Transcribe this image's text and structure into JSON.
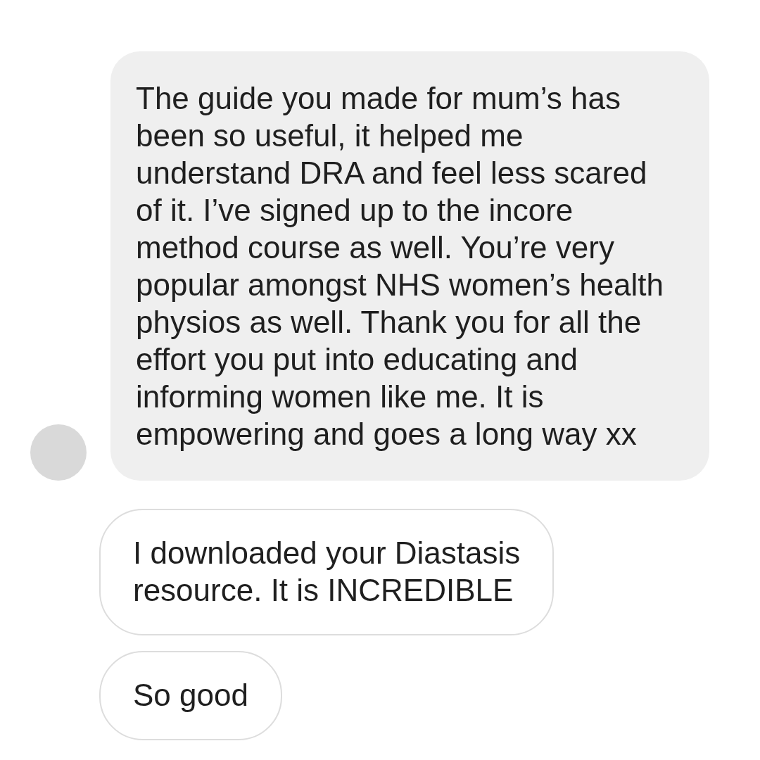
{
  "messages": [
    {
      "kind": "filled",
      "show_avatar": true,
      "text": "The guide you made for mum’s has\nbeen so useful, it helped me\nunderstand DRA and feel less scared\nof it. I’ve signed up to the incore\nmethod course as well. You’re very\npopular amongst NHS women’s health\nphysios as well. Thank you for all the\neffort you put into educating and\ninforming women like me. It is\nempowering and goes a long way xx"
    },
    {
      "kind": "outlined",
      "show_avatar": false,
      "text": "I downloaded your Diastasis\nresource. It is INCREDIBLE"
    },
    {
      "kind": "outlined",
      "show_avatar": false,
      "text": "So good"
    }
  ]
}
